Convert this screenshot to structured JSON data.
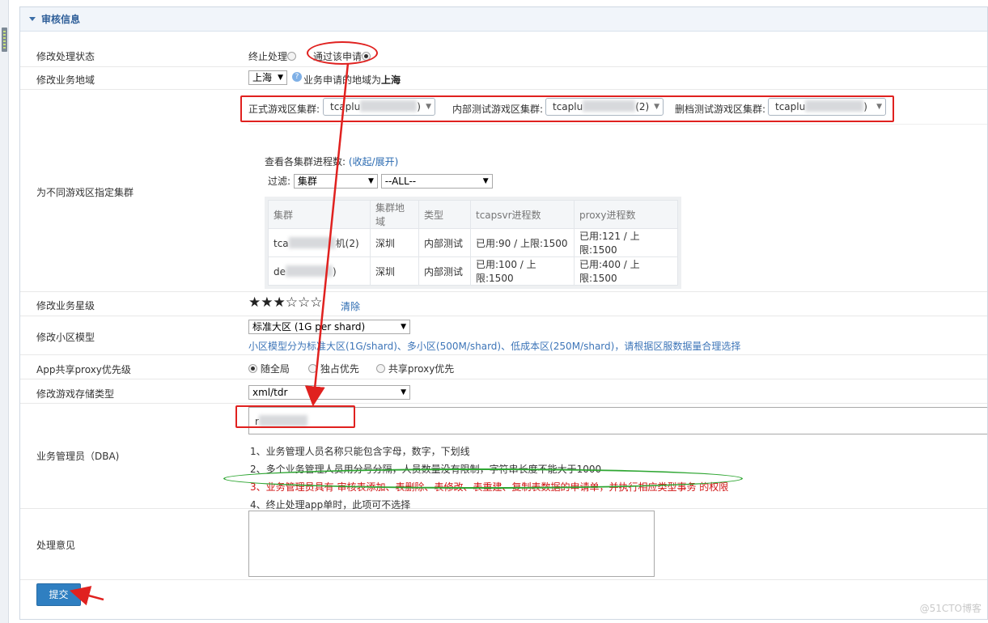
{
  "panel": {
    "title": "审核信息"
  },
  "status": {
    "label": "修改处理状态",
    "options": [
      "终止处理",
      "通过该申请"
    ],
    "selected": 1
  },
  "region": {
    "label": "修改业务地域",
    "value": "上海",
    "hint": "业务申请的地域为",
    "hint_region": "上海"
  },
  "clusters": {
    "label": "为不同游戏区指定集群",
    "selectors": [
      {
        "label": "正式游戏区集群:",
        "value_prefix": "tcaplu",
        "value_suffix": ")"
      },
      {
        "label": "内部测试游戏区集群:",
        "value_prefix": "tcaplu",
        "value_suffix": "(2)"
      },
      {
        "label": "删档测试游戏区集群:",
        "value_prefix": "tcaplu",
        "value_suffix": ")"
      }
    ],
    "process_title": "查看各集群进程数:",
    "toggle_link": "(收起/展开)",
    "filter_label": "过滤:",
    "filter_field": "集群",
    "filter_value": "--ALL--",
    "table": {
      "headers": [
        "集群",
        "集群地域",
        "类型",
        "tcapsvr进程数",
        "proxy进程数"
      ],
      "rows": [
        {
          "cluster_prefix": "tca",
          "cluster_suffix": "机(2)",
          "region": "深圳",
          "type": "内部测试",
          "tcapsvr": "已用:90 / 上限:1500",
          "proxy": "已用:121 / 上限:1500"
        },
        {
          "cluster_prefix": "de",
          "cluster_suffix": ")",
          "region": "深圳",
          "type": "内部测试",
          "tcapsvr": "已用:100 / 上限:1500",
          "proxy": "已用:400 / 上限:1500"
        }
      ]
    }
  },
  "star": {
    "label": "修改业务星级",
    "value": 3,
    "max": 5,
    "filled_glyphs": "★★★",
    "empty_glyphs": "☆☆☆",
    "clear_label": "清除"
  },
  "zone_model": {
    "label": "修改小区模型",
    "value": "标准大区 (1G per shard)",
    "hint": "小区模型分为标准大区(1G/shard)、多小区(500M/shard)、低成本区(250M/shard)，请根据区服数据量合理选择"
  },
  "proxy_priority": {
    "label": "App共享proxy优先级",
    "options": [
      "随全局",
      "独占优先",
      "共享proxy优先"
    ],
    "selected": 0
  },
  "storage": {
    "label": "修改游戏存储类型",
    "value": "xml/tdr"
  },
  "dba": {
    "label": "业务管理员（DBA)",
    "input_value_prefix": "r",
    "notes": [
      "1、业务管理人员名称只能包含字母，数字，下划线",
      "2、多个业务管理人员用分号分隔，人员数量没有限制，字符串长度不能大于1000",
      "3、业务管理员具有 审核表添加、表删除、表修改、表重建、复制表数据的申请单，并执行相应类型事务 的权限",
      "4、终止处理app单时，此项可不选择"
    ]
  },
  "opinion": {
    "label": "处理意见",
    "value": ""
  },
  "submit": {
    "label": "提交"
  },
  "watermark": "@51CTO博客",
  "colors": {
    "accent": "#2f7fc1",
    "annotation_red": "#e0211f",
    "annotation_green": "#2ea632",
    "warning_text": "#d01010"
  }
}
